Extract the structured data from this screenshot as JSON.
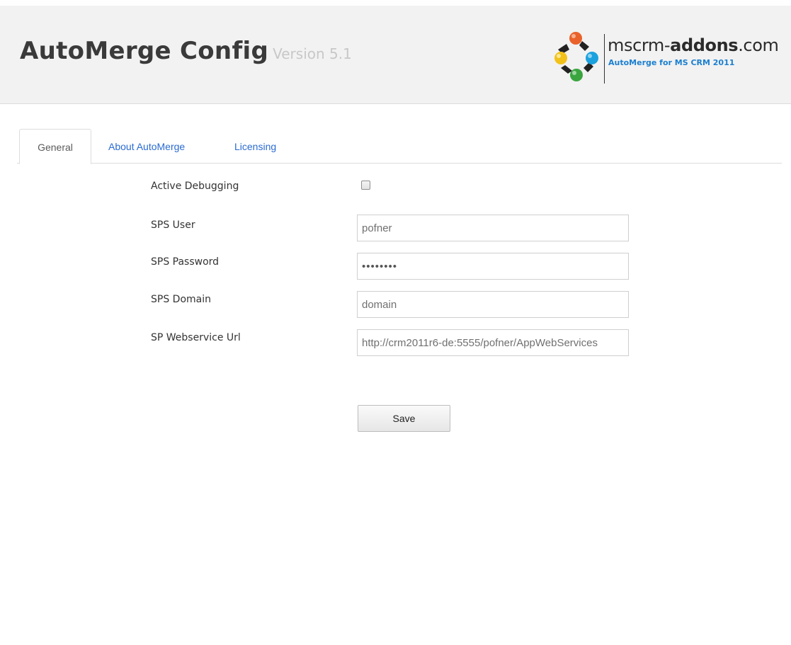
{
  "header": {
    "title": "AutoMerge Config",
    "version": "Version 5.1",
    "logo": {
      "name_prefix": "mscrm-",
      "name_bold": "addons",
      "name_suffix": ".com",
      "subtitle": "AutoMerge for MS CRM 2011"
    }
  },
  "tabs": [
    {
      "label": "General",
      "active": true
    },
    {
      "label": "About AutoMerge",
      "active": false
    },
    {
      "label": "Licensing",
      "active": false
    }
  ],
  "form": {
    "active_debugging": {
      "label": "Active Debugging",
      "checked": false
    },
    "sps_user": {
      "label": "SPS User",
      "value": "pofner"
    },
    "sps_password": {
      "label": "SPS Password",
      "value": "••••••••"
    },
    "sps_domain": {
      "label": "SPS Domain",
      "value": "domain"
    },
    "sp_webservice_url": {
      "label": "SP Webservice Url",
      "value": "http://crm2011r6-de:5555/pofner/AppWebServices"
    },
    "save_label": "Save"
  },
  "colors": {
    "header_bg": "#f2f2f2",
    "tab_link": "#2a6bd1",
    "logo_sub": "#1b7fd0"
  }
}
